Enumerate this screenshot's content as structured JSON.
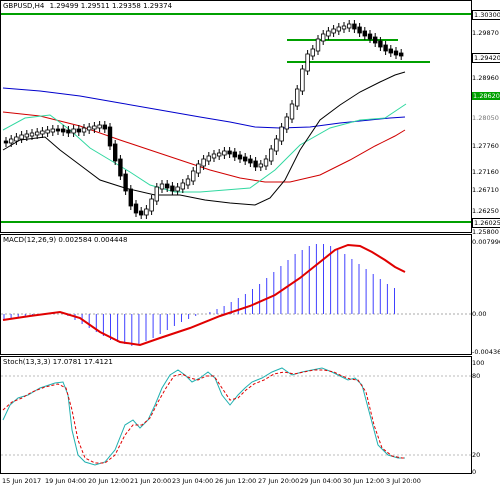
{
  "main": {
    "symbol": "GBPUSD,H4",
    "ohlc": "1.29499 1.29511 1.29358 1.29374",
    "price_labels": [
      {
        "value": "1.30300",
        "style": "boxed"
      },
      {
        "value": "1.29870",
        "style": "plain"
      },
      {
        "value": "1.29420",
        "style": "boxed"
      },
      {
        "value": "1.28960",
        "style": "plain"
      },
      {
        "value": "1.28620",
        "style": "green"
      },
      {
        "value": "1.28050",
        "style": "grey"
      },
      {
        "value": "1.27760",
        "style": "plain"
      },
      {
        "value": "1.27160",
        "style": "plain"
      },
      {
        "value": "1.26710",
        "style": "plain"
      },
      {
        "value": "1.26250",
        "style": "plain"
      },
      {
        "value": "1.26025",
        "style": "boxed"
      },
      {
        "value": "1.25800",
        "style": "plain"
      }
    ]
  },
  "macd": {
    "title": "MACD(12,26,9) 0.002584 0.004448",
    "labels": [
      "0.007996",
      "0.00",
      "-0.004366"
    ]
  },
  "stoch": {
    "title": "Stoch(13,3,3) 17.0781 17.4121",
    "labels": [
      "100",
      "80",
      "20",
      "0"
    ]
  },
  "time_axis": [
    "15 Jun 2017",
    "19 Jun 04:00",
    "20 Jun 12:00",
    "21 Jun 20:00",
    "23 Jun 04:00",
    "26 Jun 12:00",
    "27 Jun 20:00",
    "29 Jun 04:00",
    "30 Jun 12:00",
    "3 Jul 20:00"
  ],
  "colors": {
    "bull_bear": "#000000",
    "support_resistance": "#00a000",
    "ma_blue": "#0000cc",
    "ma_red": "#d00000",
    "ma_teal": "#30d8a0",
    "ma_black": "#000000",
    "macd_hist": "#4040ff",
    "macd_signal": "#e00000",
    "stoch_main": "#20b0b0",
    "stoch_signal": "#e00000"
  }
}
